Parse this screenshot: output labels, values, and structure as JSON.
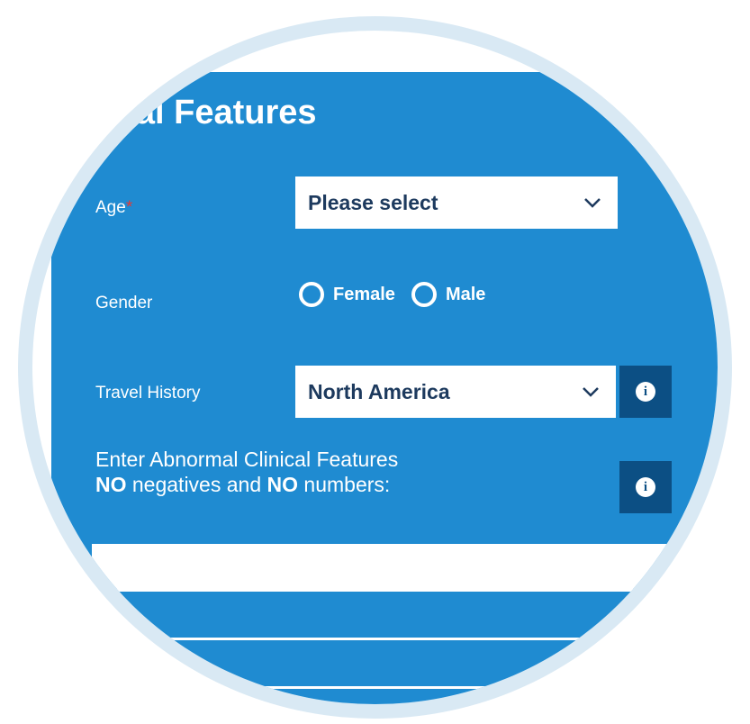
{
  "form": {
    "title": "nical Features",
    "age": {
      "label": "Age",
      "required_mark": "*",
      "value": "Please select"
    },
    "gender": {
      "label": "Gender",
      "options": [
        "Female",
        "Male"
      ]
    },
    "travel_history": {
      "label": "Travel History",
      "value": "North America"
    },
    "clinical_features": {
      "line1": "Enter Abnormal Clinical Features",
      "no1": "NO",
      "mid": " negatives and ",
      "no2": "NO",
      "end": " numbers:",
      "input_value": ""
    },
    "info_glyph": "i"
  },
  "colors": {
    "panel": "#1f8bd1",
    "info_button": "#0c4f84",
    "ring": "#d9e9f4",
    "required": "#e53935",
    "select_text": "#1d3a5e"
  },
  "icons": {
    "dropdown": "chevron-down-icon",
    "info": "info-icon"
  }
}
